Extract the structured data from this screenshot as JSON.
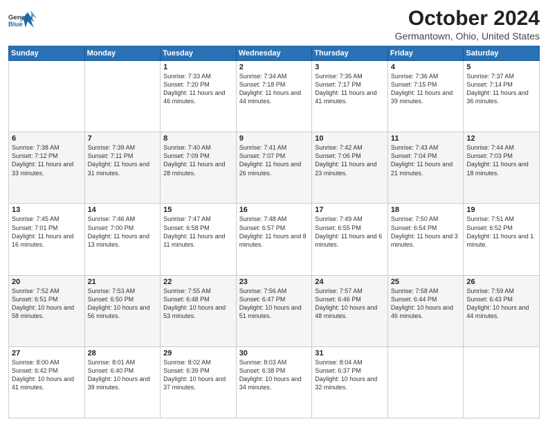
{
  "header": {
    "logo_general": "General",
    "logo_blue": "Blue",
    "title": "October 2024",
    "subtitle": "Germantown, Ohio, United States"
  },
  "days_of_week": [
    "Sunday",
    "Monday",
    "Tuesday",
    "Wednesday",
    "Thursday",
    "Friday",
    "Saturday"
  ],
  "weeks": [
    [
      {
        "day": "",
        "sunrise": "",
        "sunset": "",
        "daylight": ""
      },
      {
        "day": "",
        "sunrise": "",
        "sunset": "",
        "daylight": ""
      },
      {
        "day": "1",
        "sunrise": "Sunrise: 7:33 AM",
        "sunset": "Sunset: 7:20 PM",
        "daylight": "Daylight: 11 hours and 46 minutes."
      },
      {
        "day": "2",
        "sunrise": "Sunrise: 7:34 AM",
        "sunset": "Sunset: 7:18 PM",
        "daylight": "Daylight: 11 hours and 44 minutes."
      },
      {
        "day": "3",
        "sunrise": "Sunrise: 7:35 AM",
        "sunset": "Sunset: 7:17 PM",
        "daylight": "Daylight: 11 hours and 41 minutes."
      },
      {
        "day": "4",
        "sunrise": "Sunrise: 7:36 AM",
        "sunset": "Sunset: 7:15 PM",
        "daylight": "Daylight: 11 hours and 39 minutes."
      },
      {
        "day": "5",
        "sunrise": "Sunrise: 7:37 AM",
        "sunset": "Sunset: 7:14 PM",
        "daylight": "Daylight: 11 hours and 36 minutes."
      }
    ],
    [
      {
        "day": "6",
        "sunrise": "Sunrise: 7:38 AM",
        "sunset": "Sunset: 7:12 PM",
        "daylight": "Daylight: 11 hours and 33 minutes."
      },
      {
        "day": "7",
        "sunrise": "Sunrise: 7:39 AM",
        "sunset": "Sunset: 7:11 PM",
        "daylight": "Daylight: 11 hours and 31 minutes."
      },
      {
        "day": "8",
        "sunrise": "Sunrise: 7:40 AM",
        "sunset": "Sunset: 7:09 PM",
        "daylight": "Daylight: 11 hours and 28 minutes."
      },
      {
        "day": "9",
        "sunrise": "Sunrise: 7:41 AM",
        "sunset": "Sunset: 7:07 PM",
        "daylight": "Daylight: 11 hours and 26 minutes."
      },
      {
        "day": "10",
        "sunrise": "Sunrise: 7:42 AM",
        "sunset": "Sunset: 7:06 PM",
        "daylight": "Daylight: 11 hours and 23 minutes."
      },
      {
        "day": "11",
        "sunrise": "Sunrise: 7:43 AM",
        "sunset": "Sunset: 7:04 PM",
        "daylight": "Daylight: 11 hours and 21 minutes."
      },
      {
        "day": "12",
        "sunrise": "Sunrise: 7:44 AM",
        "sunset": "Sunset: 7:03 PM",
        "daylight": "Daylight: 11 hours and 18 minutes."
      }
    ],
    [
      {
        "day": "13",
        "sunrise": "Sunrise: 7:45 AM",
        "sunset": "Sunset: 7:01 PM",
        "daylight": "Daylight: 11 hours and 16 minutes."
      },
      {
        "day": "14",
        "sunrise": "Sunrise: 7:46 AM",
        "sunset": "Sunset: 7:00 PM",
        "daylight": "Daylight: 11 hours and 13 minutes."
      },
      {
        "day": "15",
        "sunrise": "Sunrise: 7:47 AM",
        "sunset": "Sunset: 6:58 PM",
        "daylight": "Daylight: 11 hours and 11 minutes."
      },
      {
        "day": "16",
        "sunrise": "Sunrise: 7:48 AM",
        "sunset": "Sunset: 6:57 PM",
        "daylight": "Daylight: 11 hours and 8 minutes."
      },
      {
        "day": "17",
        "sunrise": "Sunrise: 7:49 AM",
        "sunset": "Sunset: 6:55 PM",
        "daylight": "Daylight: 11 hours and 6 minutes."
      },
      {
        "day": "18",
        "sunrise": "Sunrise: 7:50 AM",
        "sunset": "Sunset: 6:54 PM",
        "daylight": "Daylight: 11 hours and 3 minutes."
      },
      {
        "day": "19",
        "sunrise": "Sunrise: 7:51 AM",
        "sunset": "Sunset: 6:52 PM",
        "daylight": "Daylight: 11 hours and 1 minute."
      }
    ],
    [
      {
        "day": "20",
        "sunrise": "Sunrise: 7:52 AM",
        "sunset": "Sunset: 6:51 PM",
        "daylight": "Daylight: 10 hours and 58 minutes."
      },
      {
        "day": "21",
        "sunrise": "Sunrise: 7:53 AM",
        "sunset": "Sunset: 6:50 PM",
        "daylight": "Daylight: 10 hours and 56 minutes."
      },
      {
        "day": "22",
        "sunrise": "Sunrise: 7:55 AM",
        "sunset": "Sunset: 6:48 PM",
        "daylight": "Daylight: 10 hours and 53 minutes."
      },
      {
        "day": "23",
        "sunrise": "Sunrise: 7:56 AM",
        "sunset": "Sunset: 6:47 PM",
        "daylight": "Daylight: 10 hours and 51 minutes."
      },
      {
        "day": "24",
        "sunrise": "Sunrise: 7:57 AM",
        "sunset": "Sunset: 6:46 PM",
        "daylight": "Daylight: 10 hours and 48 minutes."
      },
      {
        "day": "25",
        "sunrise": "Sunrise: 7:58 AM",
        "sunset": "Sunset: 6:44 PM",
        "daylight": "Daylight: 10 hours and 46 minutes."
      },
      {
        "day": "26",
        "sunrise": "Sunrise: 7:59 AM",
        "sunset": "Sunset: 6:43 PM",
        "daylight": "Daylight: 10 hours and 44 minutes."
      }
    ],
    [
      {
        "day": "27",
        "sunrise": "Sunrise: 8:00 AM",
        "sunset": "Sunset: 6:42 PM",
        "daylight": "Daylight: 10 hours and 41 minutes."
      },
      {
        "day": "28",
        "sunrise": "Sunrise: 8:01 AM",
        "sunset": "Sunset: 6:40 PM",
        "daylight": "Daylight: 10 hours and 39 minutes."
      },
      {
        "day": "29",
        "sunrise": "Sunrise: 8:02 AM",
        "sunset": "Sunset: 6:39 PM",
        "daylight": "Daylight: 10 hours and 37 minutes."
      },
      {
        "day": "30",
        "sunrise": "Sunrise: 8:03 AM",
        "sunset": "Sunset: 6:38 PM",
        "daylight": "Daylight: 10 hours and 34 minutes."
      },
      {
        "day": "31",
        "sunrise": "Sunrise: 8:04 AM",
        "sunset": "Sunset: 6:37 PM",
        "daylight": "Daylight: 10 hours and 32 minutes."
      },
      {
        "day": "",
        "sunrise": "",
        "sunset": "",
        "daylight": ""
      },
      {
        "day": "",
        "sunrise": "",
        "sunset": "",
        "daylight": ""
      }
    ]
  ]
}
